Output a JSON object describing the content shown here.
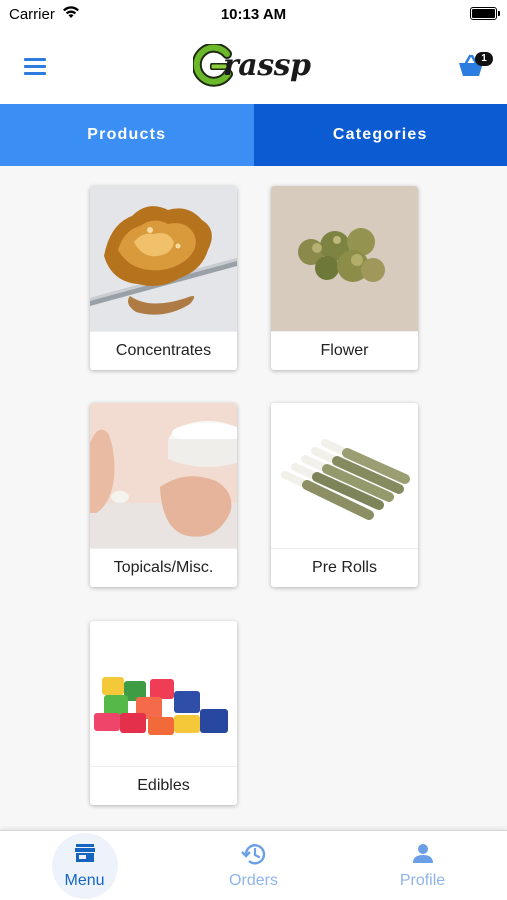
{
  "status_bar": {
    "carrier": "Carrier",
    "time": "10:13 AM"
  },
  "header": {
    "logo_text": "rassp",
    "cart_count": "1",
    "colors": {
      "accent": "#2d7de0",
      "logo_green": "#6bb82a"
    }
  },
  "tabs": [
    {
      "label": "Products",
      "color": "#3b8ef3"
    },
    {
      "label": "Categories",
      "color": "#0b5bd3",
      "selected": true
    }
  ],
  "categories": [
    {
      "label": "Concentrates",
      "image": "concentrate-image"
    },
    {
      "label": "Flower",
      "image": "flower-image"
    },
    {
      "label": "Topicals/Misc.",
      "image": "topicals-image"
    },
    {
      "label": "Pre Rolls",
      "image": "prerolls-image"
    },
    {
      "label": "Edibles",
      "image": "edibles-image"
    }
  ],
  "bottom_nav": [
    {
      "label": "Menu",
      "icon": "storefront-icon",
      "active": true
    },
    {
      "label": "Orders",
      "icon": "history-icon"
    },
    {
      "label": "Profile",
      "icon": "person-icon"
    }
  ]
}
